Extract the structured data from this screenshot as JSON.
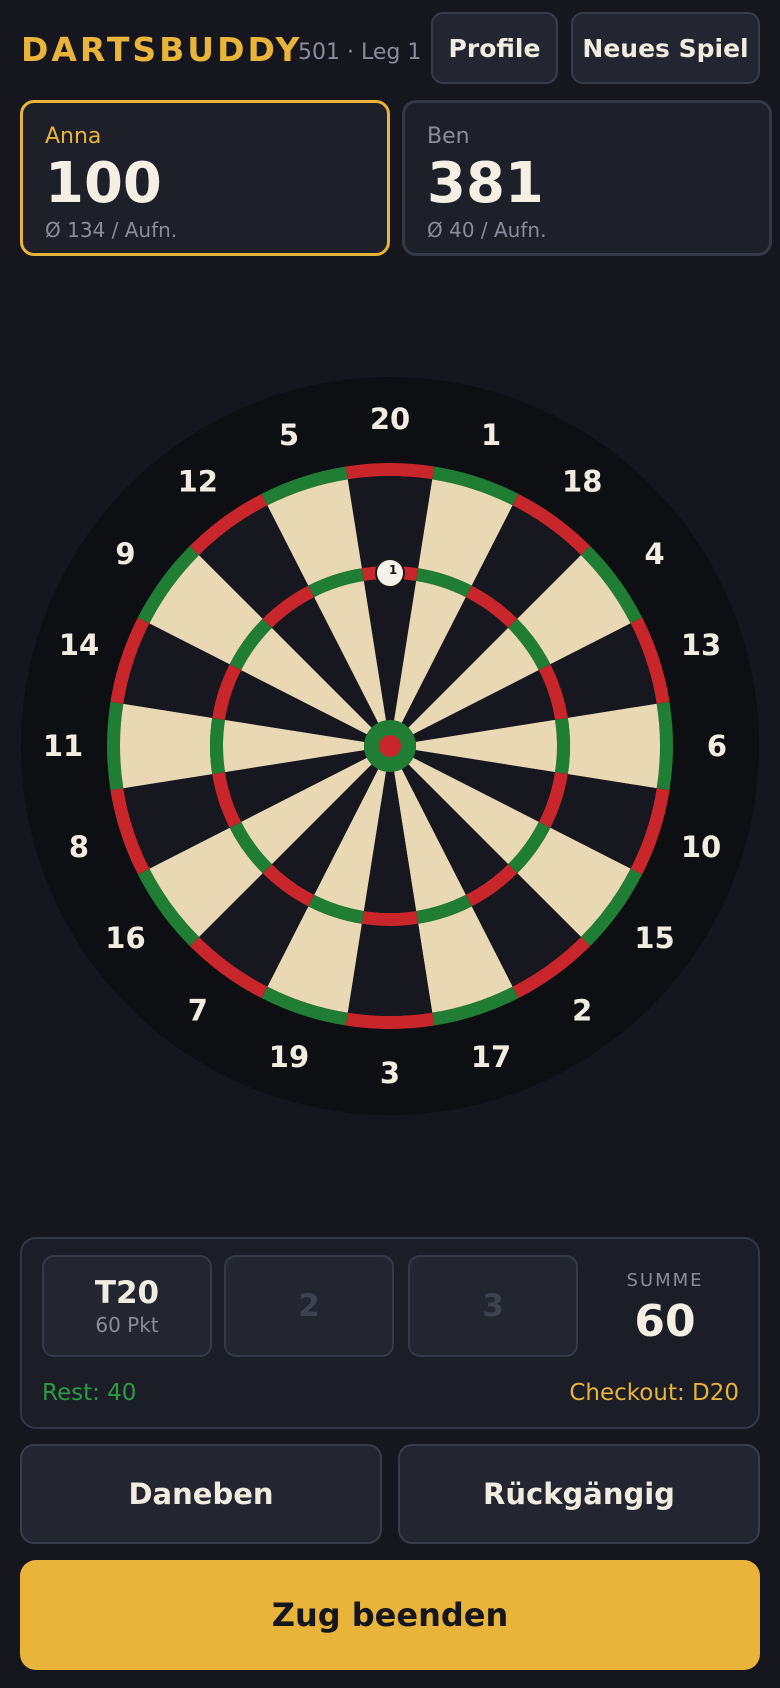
{
  "header": {
    "title": "DARTSBUDDY",
    "subtitle": "501 · Leg 1",
    "profile_label": "Profile",
    "new_game_label": "Neues Spiel"
  },
  "players": [
    {
      "name": "Anna",
      "score": "100",
      "average": "Ø 134 / Aufn.",
      "active": true
    },
    {
      "name": "Ben",
      "score": "381",
      "average": "Ø 40 / Aufn.",
      "active": false
    }
  ],
  "dartboard": {
    "numbers": [
      "20",
      "1",
      "18",
      "4",
      "13",
      "6",
      "10",
      "15",
      "2",
      "17",
      "3",
      "19",
      "7",
      "16",
      "8",
      "11",
      "14",
      "9",
      "12",
      "5"
    ],
    "marker_label": "1",
    "marker_segment": "T20"
  },
  "turn": {
    "darts": [
      {
        "main": "T20",
        "sub": "60 Pkt",
        "filled": true
      },
      {
        "main": "2",
        "sub": "",
        "filled": false
      },
      {
        "main": "3",
        "sub": "",
        "filled": false
      }
    ],
    "sum_label": "SUMME",
    "sum_value": "60",
    "rest": "Rest: 40",
    "checkout": "Checkout: D20"
  },
  "actions": {
    "miss_label": "Daneben",
    "undo_label": "Rückgängig",
    "end_turn_label": "Zug beenden"
  },
  "colors": {
    "accent": "#e8b43a",
    "board_red": "#c8262b",
    "board_green": "#1f7d34",
    "board_cream": "#e8d8b4",
    "board_dark": "#17181f"
  }
}
